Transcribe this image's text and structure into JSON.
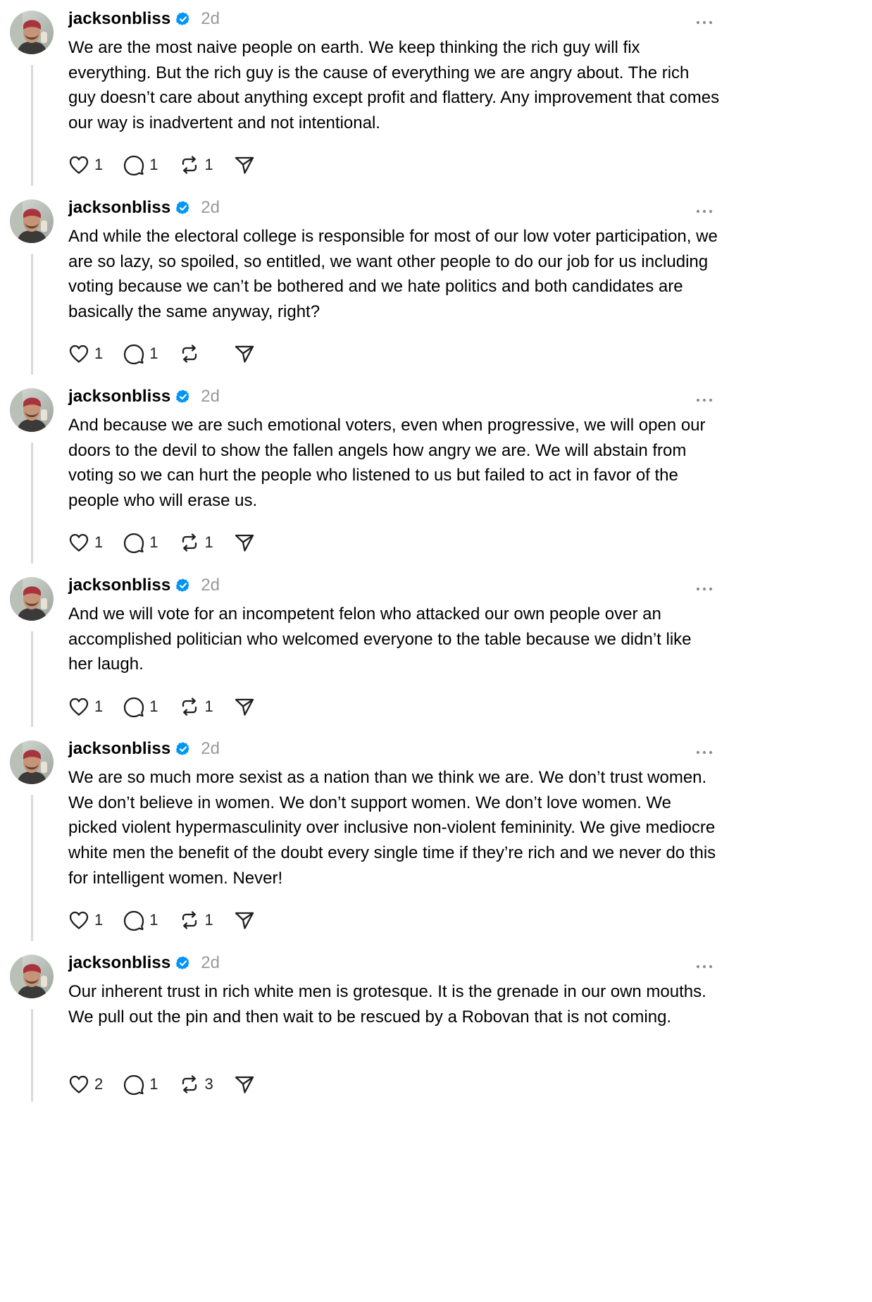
{
  "posts": [
    {
      "username": "jacksonbliss",
      "time": "2d",
      "text": "We are the most naive people on earth. We keep thinking the rich guy will fix everything. But the rich guy is the cause of everything we are angry about. The rich guy doesn’t care about anything except profit and flattery. Any improvement that comes our way is inadvertent and not intentional.",
      "likes": "1",
      "replies": "1",
      "reposts": "1"
    },
    {
      "username": "jacksonbliss",
      "time": "2d",
      "text": "And while the electoral college is responsible for most of our low voter participation, we are so lazy, so spoiled, so entitled, we want other people to do our job for us including voting because we can’t be bothered and we hate politics and both candidates are basically the same anyway, right?",
      "likes": "1",
      "replies": "1",
      "reposts": ""
    },
    {
      "username": "jacksonbliss",
      "time": "2d",
      "text": "And because we are such emotional voters, even when progressive, we will open our doors to the devil to show the fallen angels how angry we are. We will abstain from voting so we can hurt the people who listened to us but failed to act in favor of the people who will erase us.",
      "likes": "1",
      "replies": "1",
      "reposts": "1"
    },
    {
      "username": "jacksonbliss",
      "time": "2d",
      "text": "And we will vote for an incompetent felon who attacked our own people over an accomplished politician who welcomed everyone to the table because we didn’t like her laugh.",
      "likes": "1",
      "replies": "1",
      "reposts": "1"
    },
    {
      "username": "jacksonbliss",
      "time": "2d",
      "text": "We are so much more sexist as a nation than we think we are. We don’t trust women. We don’t believe in women. We don’t support women. We don’t love women. We picked violent hypermasculinity over inclusive non-violent femininity. We give mediocre white men the benefit of the doubt every single time if they’re rich and we never do this for intelligent women. Never!",
      "likes": "1",
      "replies": "1",
      "reposts": "1"
    },
    {
      "username": "jacksonbliss",
      "time": "2d",
      "text": "Our inherent trust in rich white men is grotesque. It is the grenade in our own mouths. We pull out the pin and then wait to be rescued by a Robovan that is not coming.",
      "likes": "2",
      "replies": "1",
      "reposts": "3"
    }
  ],
  "icons": {
    "like": "heart-icon",
    "reply": "speech-bubble-icon",
    "repost": "repost-arrows-icon",
    "share": "paper-plane-icon",
    "more": "ellipsis-icon",
    "verified": "verified-badge-icon"
  },
  "colors": {
    "verified": "#0095f6",
    "timestamp": "#999999",
    "thread_line": "#d9d9d9",
    "icon": "#1f1f1f"
  }
}
